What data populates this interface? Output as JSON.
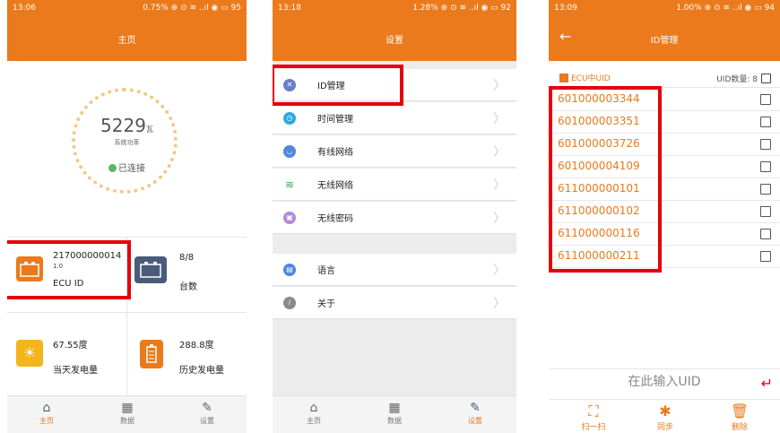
{
  "screen1": {
    "status": {
      "time": "13:06",
      "right": "0.75% ⊕ ⊙ ≋ ..ıl ◉ ▭ 95"
    },
    "title": "主页",
    "power_value": "5229",
    "power_unit": "瓦",
    "power_label": "系统功率",
    "connection": "已连接",
    "ecu_id": "217000000014",
    "ecu_version": "1.0",
    "ecu_label": "ECU ID",
    "units_value": "8/8",
    "units_label": "台数",
    "today_value": "67.55度",
    "today_label": "当天发电量",
    "history_value": "288.8度",
    "history_label": "历史发电量",
    "nav": [
      "主页",
      "数据",
      "设置"
    ]
  },
  "screen2": {
    "status": {
      "time": "13:18",
      "right": "1.28% ⊕ ⊙ ≋ ..ıl ◉ ▭ 92"
    },
    "title": "设置",
    "items": [
      "ID管理",
      "时间管理",
      "有线网络",
      "无线网络",
      "无线密码"
    ],
    "items2": [
      "语言",
      "关于"
    ],
    "nav": [
      "主页",
      "数据",
      "设置"
    ]
  },
  "screen3": {
    "status": {
      "time": "13:09",
      "right": "1.00% ⊕ ⊙ ≋ ..ıl ◉ ▭ 94"
    },
    "title": "ID管理",
    "header_label": "ECU中UID",
    "count_label": "UID数量: 8",
    "uids": [
      "601000003344",
      "601000003351",
      "601000003726",
      "601000004109",
      "611000000101",
      "611000000102",
      "611000000116",
      "611000000211"
    ],
    "input_placeholder": "在此输入UID",
    "tools": [
      "扫一扫",
      "同步",
      "删除"
    ]
  },
  "colors": {
    "accent": "#ea7a1b",
    "highlight": "#e5000c"
  }
}
